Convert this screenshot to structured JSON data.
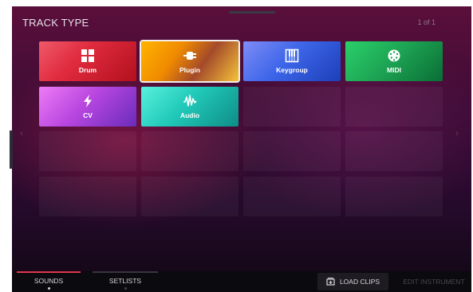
{
  "header": {
    "title": "TRACK TYPE",
    "pager": "1 of 1"
  },
  "tiles": [
    {
      "label": "Drum",
      "icon": "grid-icon",
      "color": "#e02b3e"
    },
    {
      "label": "Plugin",
      "icon": "plug-icon",
      "color": "#f08a00",
      "selected": true
    },
    {
      "label": "Keygroup",
      "icon": "piano-keys-icon",
      "color": "#3d66e9"
    },
    {
      "label": "MIDI",
      "icon": "midi-din-icon",
      "color": "#1ea655"
    },
    {
      "label": "CV",
      "icon": "lightning-icon",
      "color": "#b947e0"
    },
    {
      "label": "Audio",
      "icon": "waveform-icon",
      "color": "#21c9b8"
    }
  ],
  "nav": {
    "prev": "‹",
    "next": "›"
  },
  "bottom": {
    "tabs": [
      {
        "label": "SOUNDS",
        "active": true
      },
      {
        "label": "SETLISTS",
        "active": false
      }
    ],
    "load_clips": "LOAD CLIPS",
    "edit_instrument": "EDIT INSTRUMENT"
  },
  "colors": {
    "accent": "#e0384a",
    "selection": "#f2eeee"
  }
}
